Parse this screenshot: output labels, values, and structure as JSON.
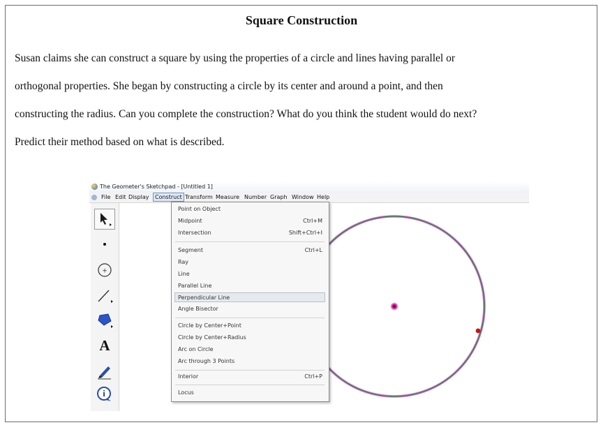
{
  "document": {
    "title": "Square Construction",
    "paragraph_lines": [
      "Susan claims she can construct a square by using the properties of a circle and lines having parallel or",
      "orthogonal properties. She began by constructing a circle by its center and around a point, and then",
      "constructing the radius. Can you complete the construction? What do you think the student would do next?",
      "Predict their method based on what is described."
    ]
  },
  "screenshot": {
    "window_title": "The Geometer's Sketchpad - [Untitled 1]",
    "menus": [
      "File",
      "Edit",
      "Display",
      "Construct",
      "Transform",
      "Measure",
      "Number",
      "Graph",
      "Window",
      "Help"
    ],
    "active_menu": "Construct",
    "toolbox": [
      "arrow-select-icon",
      "point-tool-icon",
      "compass-tool-icon",
      "straightedge-tool-icon",
      "polygon-tool-icon",
      "text-tool-icon",
      "marker-tool-icon",
      "information-tool-icon"
    ],
    "text_tool_glyph": "A",
    "info_tool_glyph": "i",
    "construct_menu": {
      "group1": [
        {
          "label": "Point on Object",
          "shortcut": ""
        },
        {
          "label": "Midpoint",
          "shortcut": "Ctrl+M"
        },
        {
          "label": "Intersection",
          "shortcut": "Shift+Ctrl+I"
        }
      ],
      "group2": [
        {
          "label": "Segment",
          "shortcut": "Ctrl+L"
        },
        {
          "label": "Ray",
          "shortcut": ""
        },
        {
          "label": "Line",
          "shortcut": ""
        },
        {
          "label": "Parallel Line",
          "shortcut": ""
        },
        {
          "label": "Perpendicular Line",
          "shortcut": "",
          "highlighted": true
        },
        {
          "label": "Angle Bisector",
          "shortcut": ""
        }
      ],
      "group3": [
        {
          "label": "Circle by Center+Point",
          "shortcut": ""
        },
        {
          "label": "Circle by Center+Radius",
          "shortcut": ""
        },
        {
          "label": "Arc on Circle",
          "shortcut": ""
        },
        {
          "label": "Arc through 3 Points",
          "shortcut": ""
        }
      ],
      "group4": [
        {
          "label": "Interior",
          "shortcut": "Ctrl+P"
        }
      ],
      "group5": [
        {
          "label": "Locus",
          "shortcut": ""
        }
      ]
    },
    "colors": {
      "circle_outer": "#d07ad6",
      "circle_inner": "#2f7a3a",
      "center_point": "#d21a8a",
      "edge_point": "#c01818",
      "menu_highlight": "#e6e9ee"
    }
  }
}
